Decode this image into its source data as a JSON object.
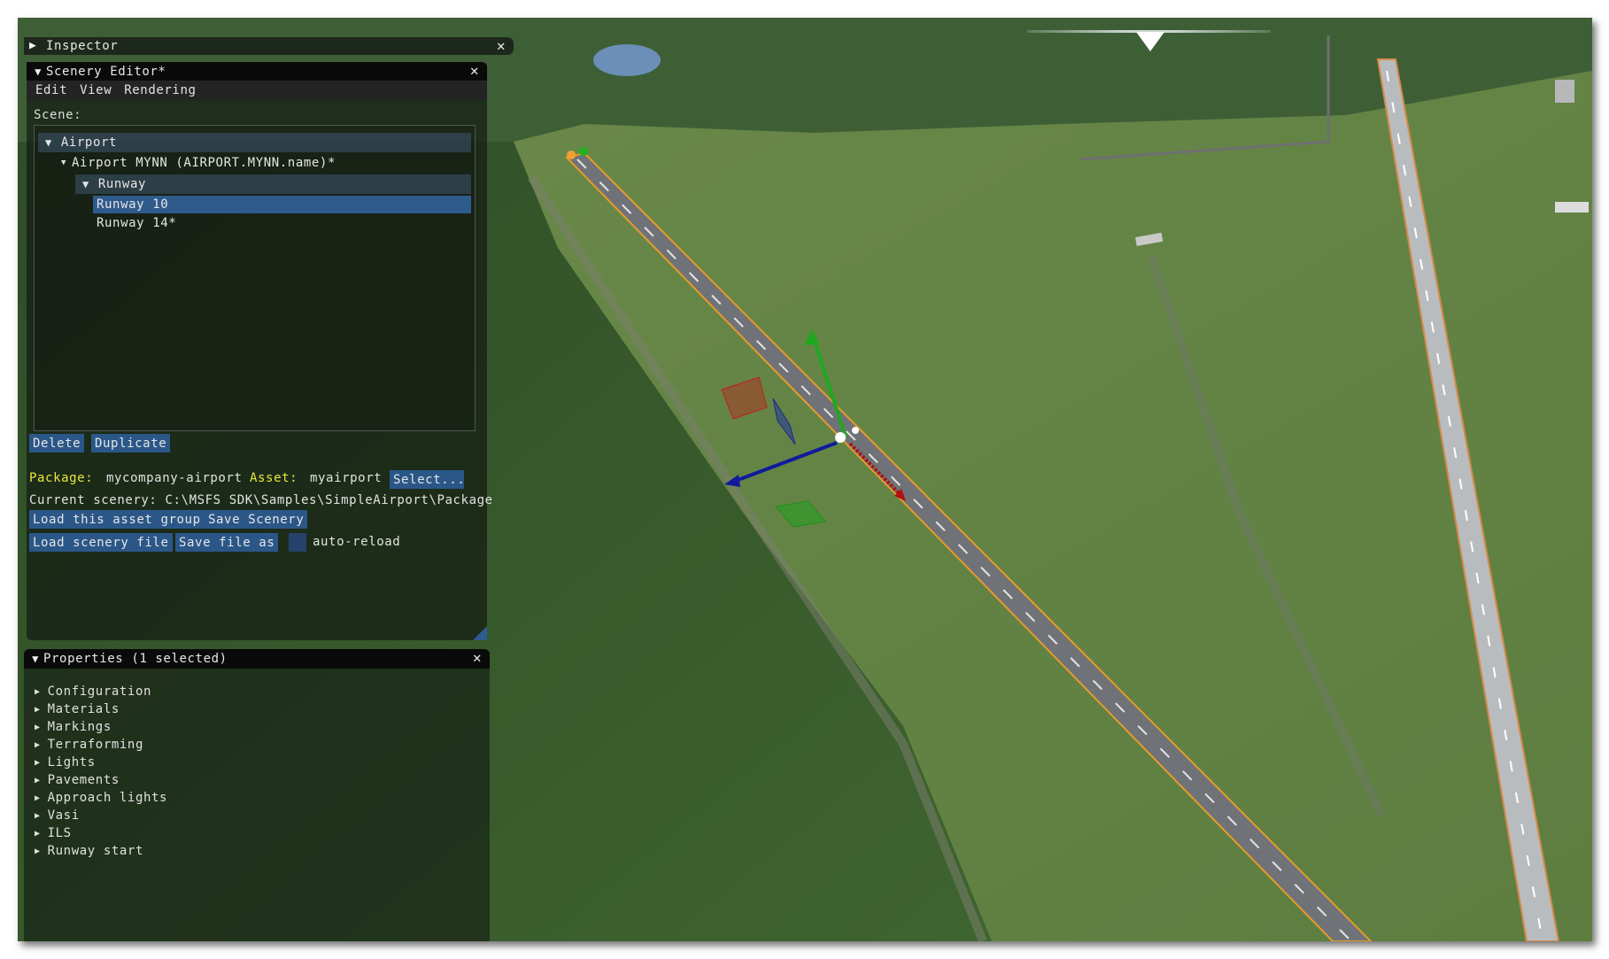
{
  "inspector": {
    "title": "Inspector",
    "expanded": false
  },
  "scenery_editor": {
    "title": "Scenery Editor*",
    "menu": [
      "Edit",
      "View",
      "Rendering"
    ],
    "scene_label": "Scene:",
    "tree": [
      {
        "label": "Airport",
        "level": 0,
        "expanded": true,
        "header": true
      },
      {
        "label": "Airport MYNN (AIRPORT.MYNN.name)*",
        "level": 1,
        "expanded": true
      },
      {
        "label": "Runway",
        "level": 2,
        "expanded": true,
        "header": true
      },
      {
        "label": "Runway 10",
        "level": 3,
        "selected": true
      },
      {
        "label": "Runway 14*",
        "level": 3
      }
    ],
    "buttons": {
      "delete": "Delete",
      "duplicate": "Duplicate"
    },
    "package_label": "Package:",
    "package_value": "mycompany-airport",
    "asset_label": "Asset:",
    "asset_value": "myairport",
    "select_button": "Select...",
    "current_scenery_label": "Current scenery:",
    "current_scenery_path": "C:\\MSFS SDK\\Samples\\SimpleAirport\\Package",
    "load_asset_group": "Load this asset group",
    "save_scenery": "Save Scenery",
    "load_scenery_file": "Load scenery file",
    "save_file_as": "Save file as",
    "auto_reload_label": "auto-reload",
    "auto_reload_checked": false
  },
  "properties": {
    "title": "Properties (1 selected)",
    "items": [
      "Configuration",
      "Materials",
      "Markings",
      "Terraforming",
      "Lights",
      "Pavements",
      "Approach lights",
      "Vasi",
      "ILS",
      "Runway start"
    ]
  },
  "icons": {
    "collapsed": "▶",
    "expanded": "▼",
    "close": "✕"
  },
  "colors": {
    "gizmo_x": "#c01010",
    "gizmo_y": "#20a020",
    "gizmo_z": "#1020a0",
    "selection_button": "#2b5788",
    "label_yellow": "#e8e83a"
  }
}
